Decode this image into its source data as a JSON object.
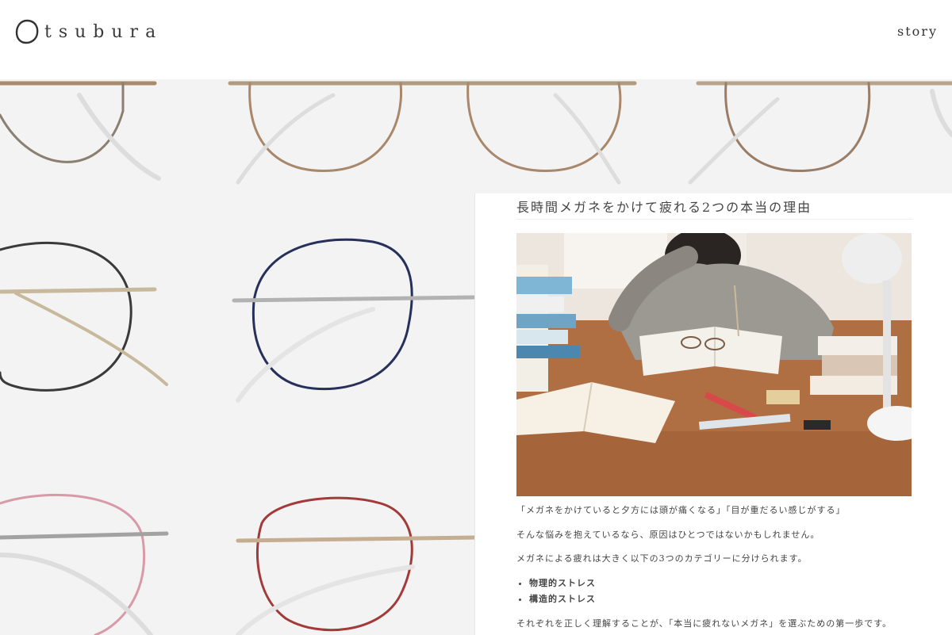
{
  "header": {
    "logo_text": "tsubura",
    "nav_story": "story"
  },
  "hero": {
    "image_description_icon": "eyeglasses-frames"
  },
  "article": {
    "title": "長時間メガネをかけて疲れる2つの本当の理由",
    "paragraphs": [
      "「メガネをかけていると夕方には頭が痛くなる」「目が重だるい感じがする」",
      "そんな悩みを抱えているなら、原因はひとつではないかもしれません。",
      "メガネによる疲れは大きく以下の3つのカテゴリーに分けられます。"
    ],
    "list": [
      "物理的ストレス",
      "構造的ストレス"
    ],
    "closing": "それぞれを正しく理解することが、「本当に疲れないメガネ」を選ぶための第一歩です。"
  },
  "colors": {
    "hero_bg": "#f3f3f3",
    "frame_gold": "#a98a6a",
    "frame_navy": "#26305a",
    "frame_pink": "#d89aa8",
    "frame_red": "#a33a3a",
    "frame_grey": "#7d7b79",
    "desk_wood": "#b06f42"
  }
}
